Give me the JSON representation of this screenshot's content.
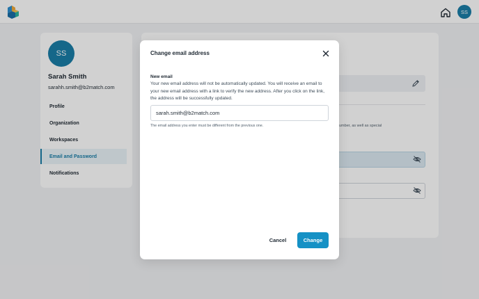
{
  "header": {
    "avatar_initials": "SS",
    "icons": {
      "logo": "cube-logo-icon",
      "home": "home-icon"
    }
  },
  "profile": {
    "avatar_initials": "SS",
    "name": "Sarah Smith",
    "email": "sarahh.smith@b2match.com",
    "nav": [
      {
        "label": "Profile",
        "active": false
      },
      {
        "label": "Organization",
        "active": false
      },
      {
        "label": "Workspaces",
        "active": false
      },
      {
        "label": "Email and Password",
        "active": true
      },
      {
        "label": "Notifications",
        "active": false
      }
    ]
  },
  "background": {
    "hint_fragment": "umber, as well as special",
    "icons": {
      "edit": "pencil-icon",
      "visibility": "eye-off-icon"
    }
  },
  "modal": {
    "title": "Change email address",
    "field_label": "New email",
    "description": "Your new email address will not be automatically updated. You will receive an email to your new email address with a link to verify the new address. After you click on the link, the address will be successfully updated.",
    "email_value": "sarah.smith@b2match.com",
    "help_text": "The email address you enter must be different from the previous one.",
    "cancel_label": "Cancel",
    "change_label": "Change"
  },
  "colors": {
    "accent": "#1591c5",
    "avatar": "#1a7ea8",
    "overlay": "rgba(0,0,0,0.18)"
  }
}
